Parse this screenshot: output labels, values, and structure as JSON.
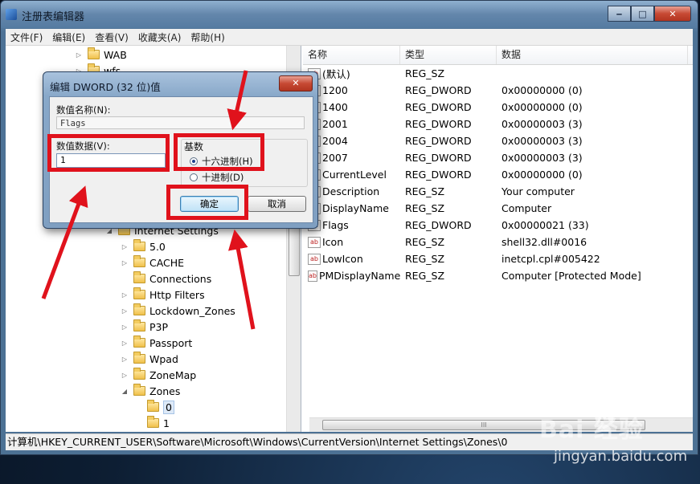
{
  "window": {
    "title": "注册表编辑器",
    "buttons": {
      "minimize": "‒",
      "maximize": "□",
      "close": "✕"
    }
  },
  "menu": [
    "文件(F)",
    "编辑(E)",
    "查看(V)",
    "收藏夹(A)",
    "帮助(H)"
  ],
  "tree": {
    "items": [
      {
        "label": "WAB",
        "indent": 0,
        "expander": "▷"
      },
      {
        "label": "wfs",
        "indent": 0,
        "expander": "▷"
      },
      {
        "label": "Internet Settings",
        "indent": -1,
        "expander": "◢"
      },
      {
        "label": "5.0",
        "indent": 1,
        "expander": "▷"
      },
      {
        "label": "CACHE",
        "indent": 1,
        "expander": "▷"
      },
      {
        "label": "Connections",
        "indent": 1,
        "expander": ""
      },
      {
        "label": "Http Filters",
        "indent": 1,
        "expander": "▷"
      },
      {
        "label": "Lockdown_Zones",
        "indent": 1,
        "expander": "▷"
      },
      {
        "label": "P3P",
        "indent": 1,
        "expander": "▷"
      },
      {
        "label": "Passport",
        "indent": 1,
        "expander": "▷"
      },
      {
        "label": "Wpad",
        "indent": 1,
        "expander": "▷"
      },
      {
        "label": "ZoneMap",
        "indent": 1,
        "expander": "▷"
      },
      {
        "label": "Zones",
        "indent": 1,
        "expander": "◢"
      },
      {
        "label": "0",
        "indent": 2,
        "expander": "",
        "selected": true
      },
      {
        "label": "1",
        "indent": 2,
        "expander": ""
      }
    ]
  },
  "list": {
    "columns": [
      "名称",
      "类型",
      "数据"
    ],
    "rows": [
      {
        "name": "(默认)",
        "type": "REG_SZ",
        "data": "",
        "icon": "string"
      },
      {
        "name": "1200",
        "type": "REG_DWORD",
        "data": "0x00000000 (0)",
        "icon": "dword"
      },
      {
        "name": "1400",
        "type": "REG_DWORD",
        "data": "0x00000000 (0)",
        "icon": "dword"
      },
      {
        "name": "2001",
        "type": "REG_DWORD",
        "data": "0x00000003 (3)",
        "icon": "dword"
      },
      {
        "name": "2004",
        "type": "REG_DWORD",
        "data": "0x00000003 (3)",
        "icon": "dword"
      },
      {
        "name": "2007",
        "type": "REG_DWORD",
        "data": "0x00000003 (3)",
        "icon": "dword"
      },
      {
        "name": "CurrentLevel",
        "type": "REG_DWORD",
        "data": "0x00000000 (0)",
        "icon": "dword"
      },
      {
        "name": "Description",
        "type": "REG_SZ",
        "data": "Your computer",
        "icon": "string"
      },
      {
        "name": "DisplayName",
        "type": "REG_SZ",
        "data": "Computer",
        "icon": "string"
      },
      {
        "name": "Flags",
        "type": "REG_DWORD",
        "data": "0x00000021 (33)",
        "icon": "dword"
      },
      {
        "name": "Icon",
        "type": "REG_SZ",
        "data": "shell32.dll#0016",
        "icon": "string"
      },
      {
        "name": "LowIcon",
        "type": "REG_SZ",
        "data": "inetcpl.cpl#005422",
        "icon": "string"
      },
      {
        "name": "PMDisplayName",
        "type": "REG_SZ",
        "data": "Computer [Protected Mode]",
        "icon": "string"
      }
    ],
    "scroll_center_glyph": "III"
  },
  "status": "计算机\\HKEY_CURRENT_USER\\Software\\Microsoft\\Windows\\CurrentVersion\\Internet Settings\\Zones\\0",
  "dialog": {
    "title": "编辑 DWORD (32 位)值",
    "close_glyph": "✕",
    "value_name_label": "数值名称(N):",
    "value_name": "Flags",
    "value_data_label": "数值数据(V):",
    "value_data": "1",
    "base_label": "基数",
    "hex_label": "十六进制(H)",
    "dec_label": "十进制(D)",
    "ok_label": "确定",
    "cancel_label": "取消"
  },
  "colors": {
    "highlight": "#e0121c"
  },
  "watermark": {
    "logo": "Bai  经验",
    "url": "jingyan.baidu.com"
  }
}
